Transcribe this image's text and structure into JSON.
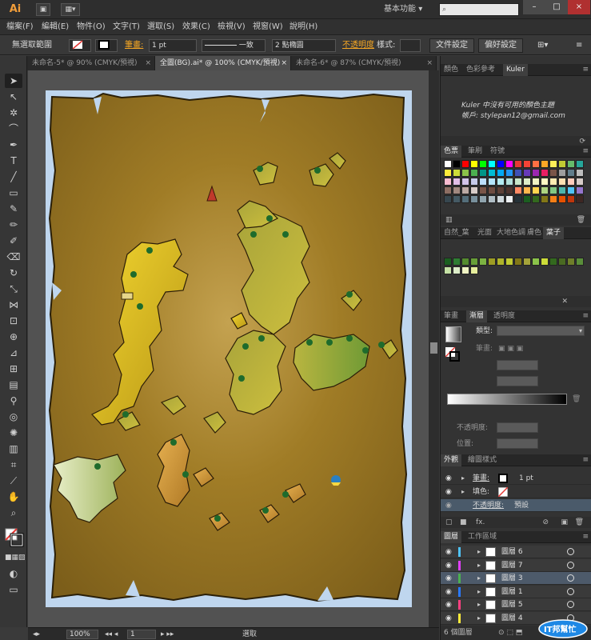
{
  "app": {
    "logo": "Ai",
    "workspace": "基本功能",
    "workspace_arrow": "▾",
    "search_placeholder": ""
  },
  "menus": [
    {
      "label": "檔案(F)"
    },
    {
      "label": "編輯(E)"
    },
    {
      "label": "物件(O)"
    },
    {
      "label": "文字(T)"
    },
    {
      "label": "選取(S)"
    },
    {
      "label": "效果(C)"
    },
    {
      "label": "檢視(V)"
    },
    {
      "label": "視窗(W)"
    },
    {
      "label": "說明(H)"
    }
  ],
  "control_bar": {
    "selection": "無選取範圍",
    "stroke_label": "筆畫:",
    "stroke_weight": "1 pt",
    "line_style": "一致",
    "brush": "2 點橢圓",
    "opacity_label": "不透明度",
    "style_label": "樣式:",
    "doc_setup": "文件設定",
    "preferences": "偏好設定"
  },
  "doc_tabs": [
    {
      "label": "未命名-5* @ 90% (CMYK/預視)",
      "close": "×",
      "active": false
    },
    {
      "label": "全圖(BG).ai* @ 100% (CMYK/預視)",
      "close": "×",
      "active": true
    },
    {
      "label": "未命名-6* @ 87% (CMYK/預視)",
      "close": "×",
      "active": false
    }
  ],
  "status_bar": {
    "zoom": "100%",
    "page": "1",
    "tool": "選取"
  },
  "panels": {
    "color_tabs": [
      "顏色",
      "色彩參考",
      "Kuler"
    ],
    "kuler_message": "Kuler 中沒有可用的顏色主題",
    "kuler_account": "帳戶: stylepan12@gmail.com",
    "swatch_tabs": [
      "色票",
      "筆刷",
      "符號"
    ],
    "library_tabs": [
      "自然_葉",
      "光面",
      "大地色調",
      "膚色",
      "葉子"
    ],
    "gradient_tabs": [
      "筆畫",
      "漸層",
      "透明度"
    ],
    "gradient_type_label": "類型:",
    "gradient_stroke_label": "筆畫:",
    "gradient_opacity_label": "不透明度:",
    "gradient_position_label": "位置:",
    "appearance_tabs": [
      "外觀",
      "繪圖樣式"
    ],
    "appearance_rows": [
      {
        "label": "筆畫:",
        "value": "1 pt",
        "orange": true
      },
      {
        "label": "填色:",
        "value": "",
        "orange": false
      },
      {
        "label": "不透明度:",
        "value": "預設",
        "orange": true
      }
    ],
    "appearance_fx": "fx.",
    "layer_tabs": [
      "圖層",
      "工作區域"
    ],
    "layers": [
      {
        "name": "圖層 6",
        "color": "#4fc3f7",
        "selected": false
      },
      {
        "name": "圖層 7",
        "color": "#e040fb",
        "selected": false
      },
      {
        "name": "圖層 3",
        "color": "#4caf50",
        "selected": true
      },
      {
        "name": "圖層 1",
        "color": "#2979ff",
        "selected": false
      },
      {
        "name": "圖層 5",
        "color": "#ff4081",
        "selected": false
      },
      {
        "name": "圖層 4",
        "color": "#ffeb3b",
        "selected": false
      }
    ],
    "layer_count": "6 個圖層"
  },
  "watermark": "IT邦幫忙",
  "colors": {
    "parchment": "#8b6a1e",
    "accent_orange": "#f5a623",
    "island_yellow": "#d4b326",
    "island_green": "#8aa43a"
  }
}
